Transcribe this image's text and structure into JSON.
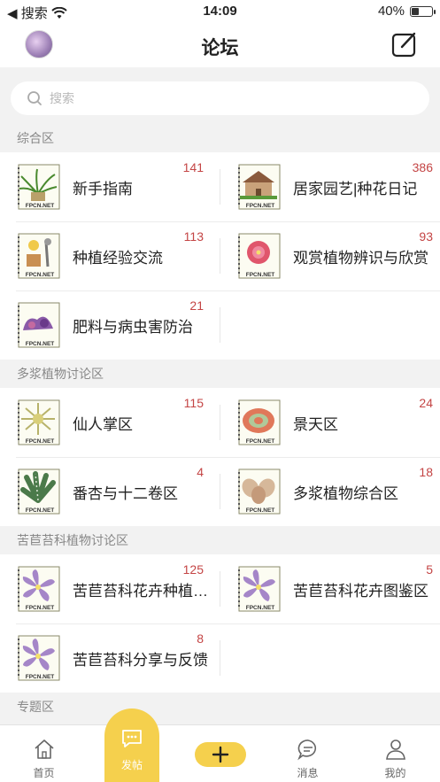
{
  "status": {
    "back_label": "◀ 搜索",
    "time": "14:09",
    "battery_text": "40%",
    "battery_level": 0.4
  },
  "nav": {
    "title": "论坛"
  },
  "search": {
    "placeholder": "搜索"
  },
  "sections": [
    {
      "title": "综合区",
      "boards": [
        {
          "name": "新手指南",
          "count": "141",
          "thumb": "spider-plant"
        },
        {
          "name": "居家园艺|种花日记",
          "count": "386",
          "thumb": "house"
        },
        {
          "name": "种植经验交流",
          "count": "113",
          "thumb": "pot-tools"
        },
        {
          "name": "观赏植物辨识与欣赏",
          "count": "93",
          "thumb": "pink-flower"
        },
        {
          "name": "肥料与病虫害防治",
          "count": "21",
          "thumb": "fertilizer"
        }
      ]
    },
    {
      "title": "多浆植物讨论区",
      "boards": [
        {
          "name": "仙人掌区",
          "count": "115",
          "thumb": "cactus"
        },
        {
          "name": "景天区",
          "count": "24",
          "thumb": "echeveria"
        },
        {
          "name": "番杏与十二卷区",
          "count": "4",
          "thumb": "haworthia"
        },
        {
          "name": "多浆植物综合区",
          "count": "18",
          "thumb": "succulent"
        }
      ]
    },
    {
      "title": "苦苣苔科植物讨论区",
      "boards": [
        {
          "name": "苦苣苔科花卉种植…",
          "count": "125",
          "thumb": "violet"
        },
        {
          "name": "苦苣苔科花卉图鉴区",
          "count": "5",
          "thumb": "violet"
        },
        {
          "name": "苦苣苔科分享与反馈",
          "count": "8",
          "thumb": "violet"
        }
      ]
    },
    {
      "title": "专题区",
      "boards": []
    }
  ],
  "thumb_caption": "FPCN.NET",
  "tabs": {
    "home": "首页",
    "post": "发帖",
    "messages": "消息",
    "mine": "我的"
  },
  "colors": {
    "accent": "#f5d04d",
    "count": "#c44545",
    "section_bg": "#f2f2f2"
  }
}
